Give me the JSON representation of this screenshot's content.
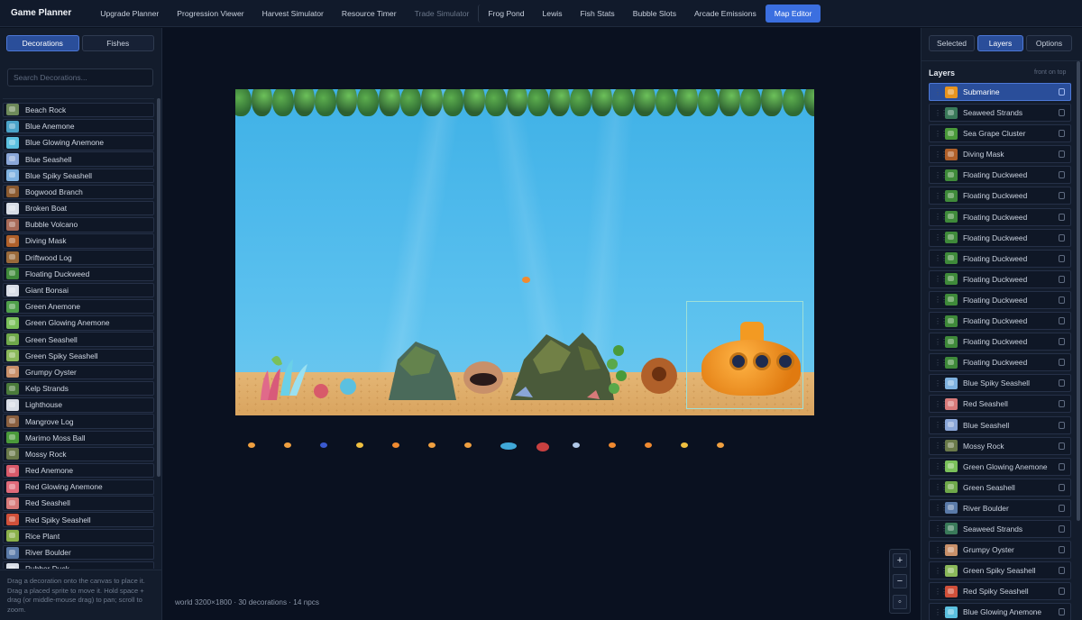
{
  "app": {
    "brand": "Game Planner",
    "nav": [
      {
        "label": "Upgrade Planner",
        "state": "normal"
      },
      {
        "label": "Progression Viewer",
        "state": "normal"
      },
      {
        "label": "Harvest Simulator",
        "state": "normal"
      },
      {
        "label": "Resource Timer",
        "state": "normal"
      },
      {
        "label": "Trade Simulator",
        "state": "disabled"
      },
      {
        "label": "Frog Pond",
        "state": "normal"
      },
      {
        "label": "Lewis",
        "state": "normal"
      },
      {
        "label": "Fish Stats",
        "state": "normal"
      },
      {
        "label": "Bubble Slots",
        "state": "normal"
      },
      {
        "label": "Arcade Emissions",
        "state": "normal"
      },
      {
        "label": "Map Editor",
        "state": "active"
      }
    ]
  },
  "left_panel": {
    "tabs": [
      {
        "label": "Decorations",
        "active": true
      },
      {
        "label": "Fishes",
        "active": false
      }
    ],
    "search_placeholder": "Search Decorations...",
    "items": [
      {
        "label": "Beach Rock",
        "icon": "beach-rock-icon",
        "color": "#6e8a5a"
      },
      {
        "label": "Blue Anemone",
        "icon": "blue-anemone-icon",
        "color": "#4aa3c8"
      },
      {
        "label": "Blue Glowing Anemone",
        "icon": "blue-glowing-anemone-icon",
        "color": "#5bc0e0"
      },
      {
        "label": "Blue Seashell",
        "icon": "blue-seashell-icon",
        "color": "#8aa6d8"
      },
      {
        "label": "Blue Spiky Seashell",
        "icon": "blue-spiky-seashell-icon",
        "color": "#7fb2e0"
      },
      {
        "label": "Bogwood Branch",
        "icon": "bogwood-branch-icon",
        "color": "#8a5a30"
      },
      {
        "label": "Broken Boat",
        "icon": "broken-boat-icon",
        "color": "#d8dde6"
      },
      {
        "label": "Bubble Volcano",
        "icon": "bubble-volcano-icon",
        "color": "#a86a58"
      },
      {
        "label": "Diving Mask",
        "icon": "diving-mask-icon",
        "color": "#b0602a"
      },
      {
        "label": "Driftwood Log",
        "icon": "driftwood-log-icon",
        "color": "#9a6a3a"
      },
      {
        "label": "Floating Duckweed",
        "icon": "floating-duckweed-icon",
        "color": "#3f8a3a"
      },
      {
        "label": "Giant Bonsai",
        "icon": "giant-bonsai-icon",
        "color": "#d8dde6"
      },
      {
        "label": "Green Anemone",
        "icon": "green-anemone-icon",
        "color": "#4fa04a"
      },
      {
        "label": "Green Glowing Anemone",
        "icon": "green-glowing-anemone-icon",
        "color": "#7ac05a"
      },
      {
        "label": "Green Seashell",
        "icon": "green-seashell-icon",
        "color": "#6fa84a"
      },
      {
        "label": "Green Spiky Seashell",
        "icon": "green-spiky-seashell-icon",
        "color": "#8ab85a"
      },
      {
        "label": "Grumpy Oyster",
        "icon": "grumpy-oyster-icon",
        "color": "#c8906a"
      },
      {
        "label": "Kelp Strands",
        "icon": "kelp-strands-icon",
        "color": "#4a7a3a"
      },
      {
        "label": "Lighthouse",
        "icon": "lighthouse-icon",
        "color": "#d8dde6"
      },
      {
        "label": "Mangrove Log",
        "icon": "mangrove-log-icon",
        "color": "#8a6040"
      },
      {
        "label": "Marimo Moss Ball",
        "icon": "marimo-moss-ball-icon",
        "color": "#4a9a3a"
      },
      {
        "label": "Mossy Rock",
        "icon": "mossy-rock-icon",
        "color": "#6a7a4a"
      },
      {
        "label": "Red Anemone",
        "icon": "red-anemone-icon",
        "color": "#d85a6a"
      },
      {
        "label": "Red Glowing Anemone",
        "icon": "red-glowing-anemone-icon",
        "color": "#e06a7a"
      },
      {
        "label": "Red Seashell",
        "icon": "red-seashell-icon",
        "color": "#d87a7a"
      },
      {
        "label": "Red Spiky Seashell",
        "icon": "red-spiky-seashell-icon",
        "color": "#d0503a"
      },
      {
        "label": "Rice Plant",
        "icon": "rice-plant-icon",
        "color": "#8ab04a"
      },
      {
        "label": "River Boulder",
        "icon": "river-boulder-icon",
        "color": "#5a7aa8"
      },
      {
        "label": "Rubber Duck",
        "icon": "rubber-duck-icon",
        "color": "#d8dde6"
      }
    ],
    "help_text": "Drag a decoration onto the canvas to place it. Drag a placed sprite to move it. Hold space + drag (or middle-mouse drag) to pan; scroll to zoom."
  },
  "canvas": {
    "status": "world 3200×1800 · 30 decorations · 14 npcs",
    "zoom_in": "+",
    "zoom_out": "−",
    "zoom_reset": "◦"
  },
  "right_panel": {
    "tabs": [
      {
        "label": "Selected",
        "active": false
      },
      {
        "label": "Layers",
        "active": true
      },
      {
        "label": "Options",
        "active": false
      }
    ],
    "layers_title": "Layers",
    "layers_hint": "front on top",
    "layers": [
      {
        "label": "Submarine",
        "selected": true,
        "color": "#e8941e"
      },
      {
        "label": "Seaweed Strands",
        "selected": false,
        "color": "#3a7a5a"
      },
      {
        "label": "Sea Grape Cluster",
        "selected": false,
        "color": "#4a9a3a"
      },
      {
        "label": "Diving Mask",
        "selected": false,
        "color": "#b0602a"
      },
      {
        "label": "Floating Duckweed",
        "selected": false,
        "color": "#3f8a3a"
      },
      {
        "label": "Floating Duckweed",
        "selected": false,
        "color": "#3f8a3a"
      },
      {
        "label": "Floating Duckweed",
        "selected": false,
        "color": "#3f8a3a"
      },
      {
        "label": "Floating Duckweed",
        "selected": false,
        "color": "#3f8a3a"
      },
      {
        "label": "Floating Duckweed",
        "selected": false,
        "color": "#3f8a3a"
      },
      {
        "label": "Floating Duckweed",
        "selected": false,
        "color": "#3f8a3a"
      },
      {
        "label": "Floating Duckweed",
        "selected": false,
        "color": "#3f8a3a"
      },
      {
        "label": "Floating Duckweed",
        "selected": false,
        "color": "#3f8a3a"
      },
      {
        "label": "Floating Duckweed",
        "selected": false,
        "color": "#3f8a3a"
      },
      {
        "label": "Floating Duckweed",
        "selected": false,
        "color": "#3f8a3a"
      },
      {
        "label": "Blue Spiky Seashell",
        "selected": false,
        "color": "#7fb2e0"
      },
      {
        "label": "Red Seashell",
        "selected": false,
        "color": "#d87a7a"
      },
      {
        "label": "Blue Seashell",
        "selected": false,
        "color": "#8aa6d8"
      },
      {
        "label": "Mossy Rock",
        "selected": false,
        "color": "#6a7a4a"
      },
      {
        "label": "Green Glowing Anemone",
        "selected": false,
        "color": "#7ac05a"
      },
      {
        "label": "Green Seashell",
        "selected": false,
        "color": "#6fa84a"
      },
      {
        "label": "River Boulder",
        "selected": false,
        "color": "#5a7aa8"
      },
      {
        "label": "Seaweed Strands",
        "selected": false,
        "color": "#3a7a5a"
      },
      {
        "label": "Grumpy Oyster",
        "selected": false,
        "color": "#c8906a"
      },
      {
        "label": "Green Spiky Seashell",
        "selected": false,
        "color": "#8ab85a"
      },
      {
        "label": "Red Spiky Seashell",
        "selected": false,
        "color": "#d0503a"
      },
      {
        "label": "Blue Glowing Anemone",
        "selected": false,
        "color": "#5bc0e0"
      }
    ]
  },
  "colors": {
    "accent": "#3b6fe0",
    "background": "#0b1220",
    "panel": "#131c2c"
  }
}
